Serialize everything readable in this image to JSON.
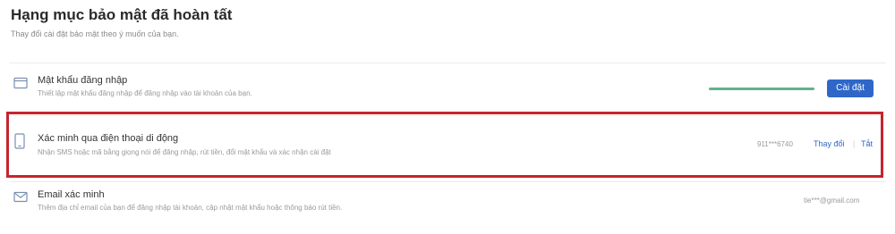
{
  "header": {
    "title": "Hạng mục bảo mật đã hoàn tất",
    "subtitle": "Thay đổi cài đặt bảo mật theo ý muốn của bạn."
  },
  "items": [
    {
      "icon": "window-icon",
      "title": "Mật khẩu đăng nhập",
      "description": "Thiết lập mật khẩu đăng nhập để đăng nhập vào tài khoản của bạn.",
      "strength_progress": 1.0,
      "strength_color": "#5fb388",
      "action_label": "Cài đặt"
    },
    {
      "icon": "phone-icon",
      "title": "Xác minh qua điện thoại di động",
      "description": "Nhận SMS hoặc mã bằng giọng nói để đăng nhập, rút tiền, đổi mật khẩu và xác nhận cài đặt",
      "value": "911***6740",
      "change_label": "Thay đổi",
      "separator": "|",
      "off_label": "Tắt",
      "highlighted": true
    },
    {
      "icon": "envelope-icon",
      "title": "Email xác minh",
      "description": "Thêm địa chỉ email của bạn để đăng nhập tài khoản, cập nhật mật khẩu hoặc thông báo rút tiền.",
      "value": "tie***@gmail.com"
    }
  ],
  "colors": {
    "accent": "#2f67c8",
    "highlight_border": "#c4252e",
    "progress": "#5fb388"
  }
}
